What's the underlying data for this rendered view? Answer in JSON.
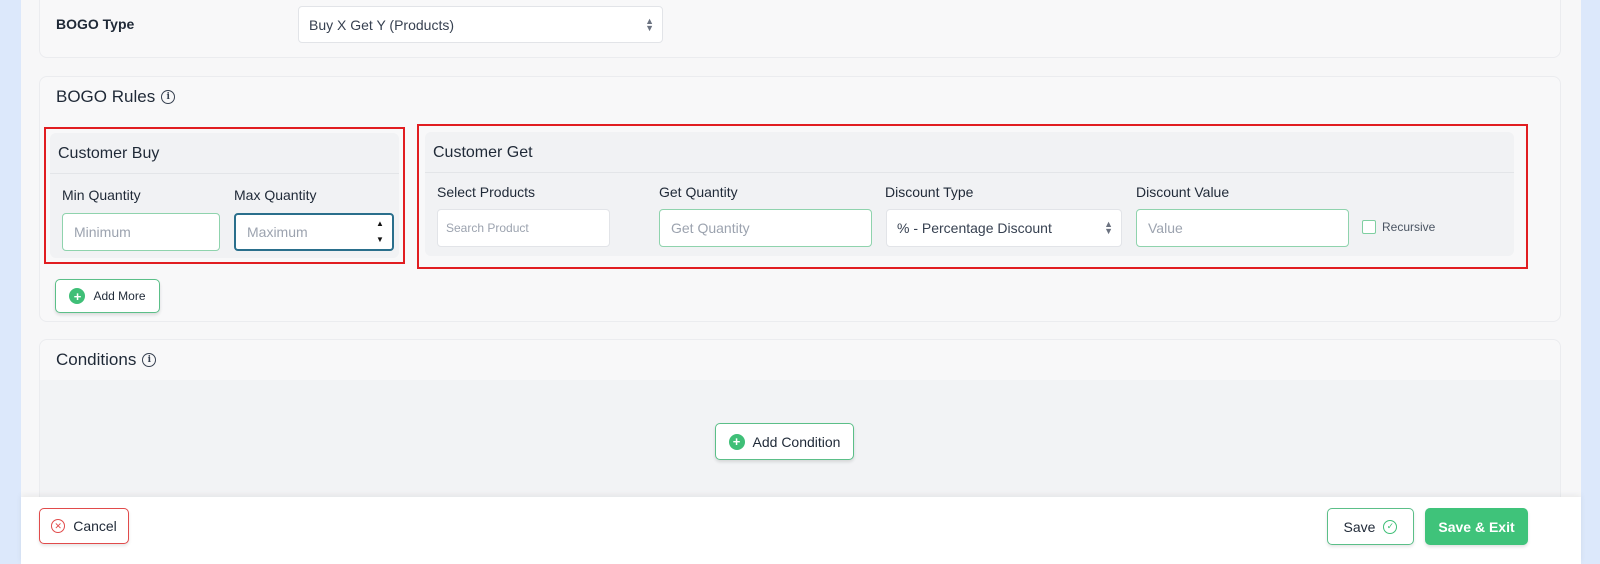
{
  "bogo_type": {
    "label": "BOGO Type",
    "selected": "Buy X Get Y (Products)"
  },
  "bogo_rules": {
    "title": "BOGO Rules",
    "customer_buy": {
      "title": "Customer Buy",
      "min_label": "Min Quantity",
      "min_placeholder": "Minimum",
      "max_label": "Max Quantity",
      "max_placeholder": "Maximum"
    },
    "customer_get": {
      "title": "Customer Get",
      "products_label": "Select Products",
      "products_placeholder": "Search Product",
      "quantity_label": "Get Quantity",
      "quantity_placeholder": "Get Quantity",
      "discount_type_label": "Discount Type",
      "discount_type_selected": "% - Percentage Discount",
      "discount_value_label": "Discount Value",
      "discount_value_placeholder": "Value",
      "recursive_label": "Recursive"
    },
    "add_more_label": "Add More"
  },
  "conditions": {
    "title": "Conditions",
    "add_condition_label": "Add Condition"
  },
  "footer": {
    "cancel_label": "Cancel",
    "save_label": "Save",
    "save_exit_label": "Save & Exit"
  },
  "colors": {
    "highlight_red": "#e11d21",
    "accent_green": "#3fc37a",
    "page_background": "#dce8fb"
  }
}
